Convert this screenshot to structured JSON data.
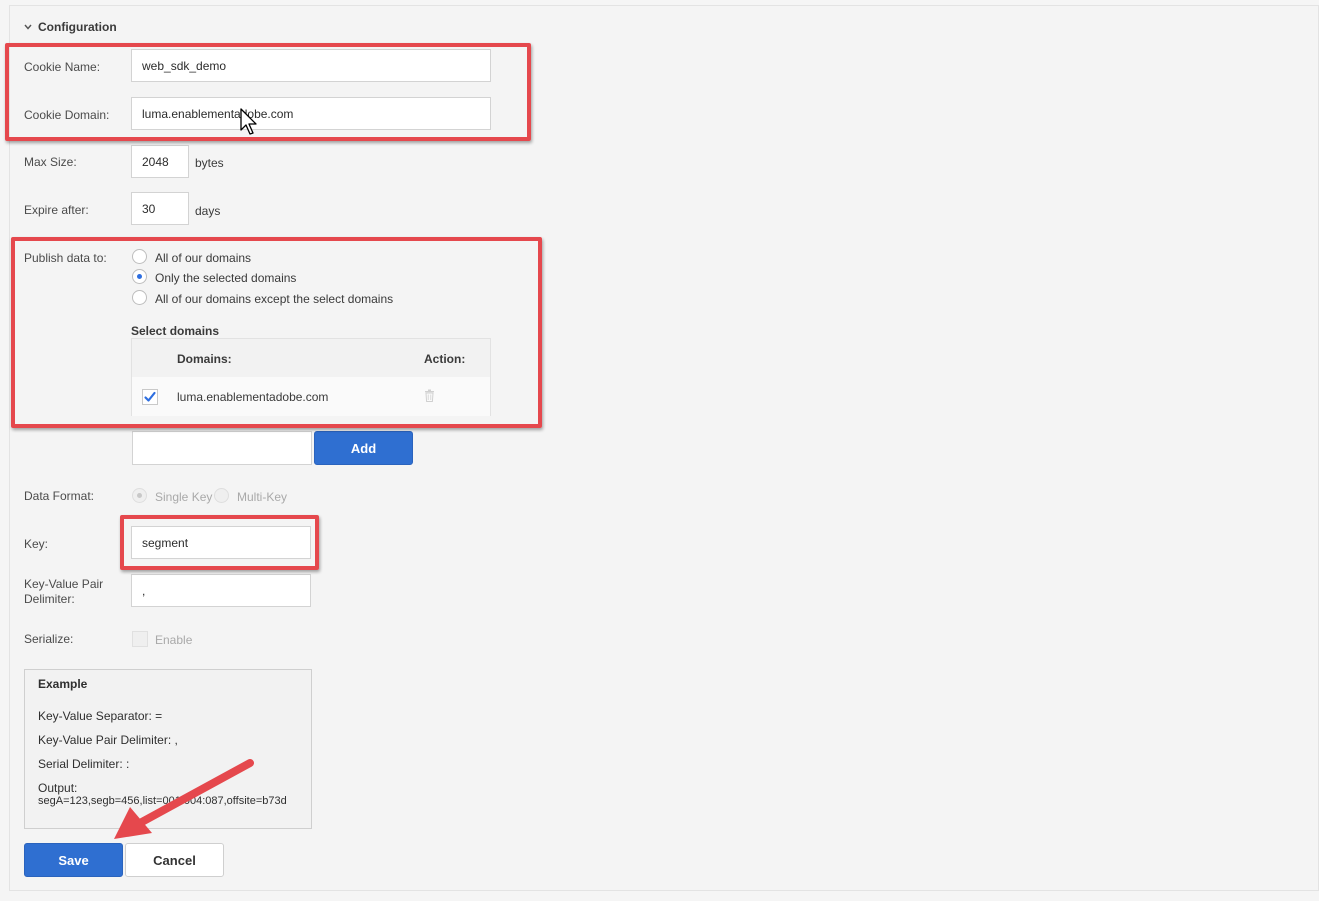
{
  "section": {
    "title": "Configuration"
  },
  "fields": {
    "cookie_name": {
      "label": "Cookie Name:",
      "value": "web_sdk_demo"
    },
    "cookie_domain": {
      "label": "Cookie Domain:",
      "value": "luma.enablementadobe.com"
    },
    "max_size": {
      "label": "Max Size:",
      "value": "2048",
      "unit": "bytes"
    },
    "expire_after": {
      "label": "Expire after:",
      "value": "30",
      "unit": "days"
    }
  },
  "publish": {
    "label": "Publish data to:",
    "options": [
      {
        "label": "All of our domains",
        "checked": false
      },
      {
        "label": "Only the selected domains",
        "checked": true
      },
      {
        "label": "All of our domains except the select domains",
        "checked": false
      }
    ],
    "select_domains_title": "Select domains",
    "table": {
      "col_domains": "Domains:",
      "col_action": "Action:",
      "rows": [
        {
          "domain": "luma.enablementadobe.com",
          "checked": true
        }
      ]
    },
    "add_label": "Add"
  },
  "data_format": {
    "label": "Data Format:",
    "options": [
      {
        "label": "Single Key",
        "checked": true
      },
      {
        "label": "Multi-Key",
        "checked": false
      }
    ]
  },
  "key": {
    "label": "Key:",
    "value": "segment"
  },
  "kv_delimiter": {
    "label_line1": "Key-Value Pair",
    "label_line2": "Delimiter:",
    "value": ","
  },
  "serialize": {
    "label": "Serialize:",
    "option": "Enable"
  },
  "example": {
    "title": "Example",
    "kv_separator": "Key-Value Separator: =",
    "kv_pair_delimiter": "Key-Value Pair Delimiter: ,",
    "serial_delimiter": "Serial Delimiter: :",
    "output_label": "Output:",
    "output_value": "segA=123,segb=456,list=001:004:087,offsite=b73d"
  },
  "buttons": {
    "save": "Save",
    "cancel": "Cancel"
  },
  "colors": {
    "primary": "#2f6fd1",
    "annotation": "#e5484d"
  }
}
